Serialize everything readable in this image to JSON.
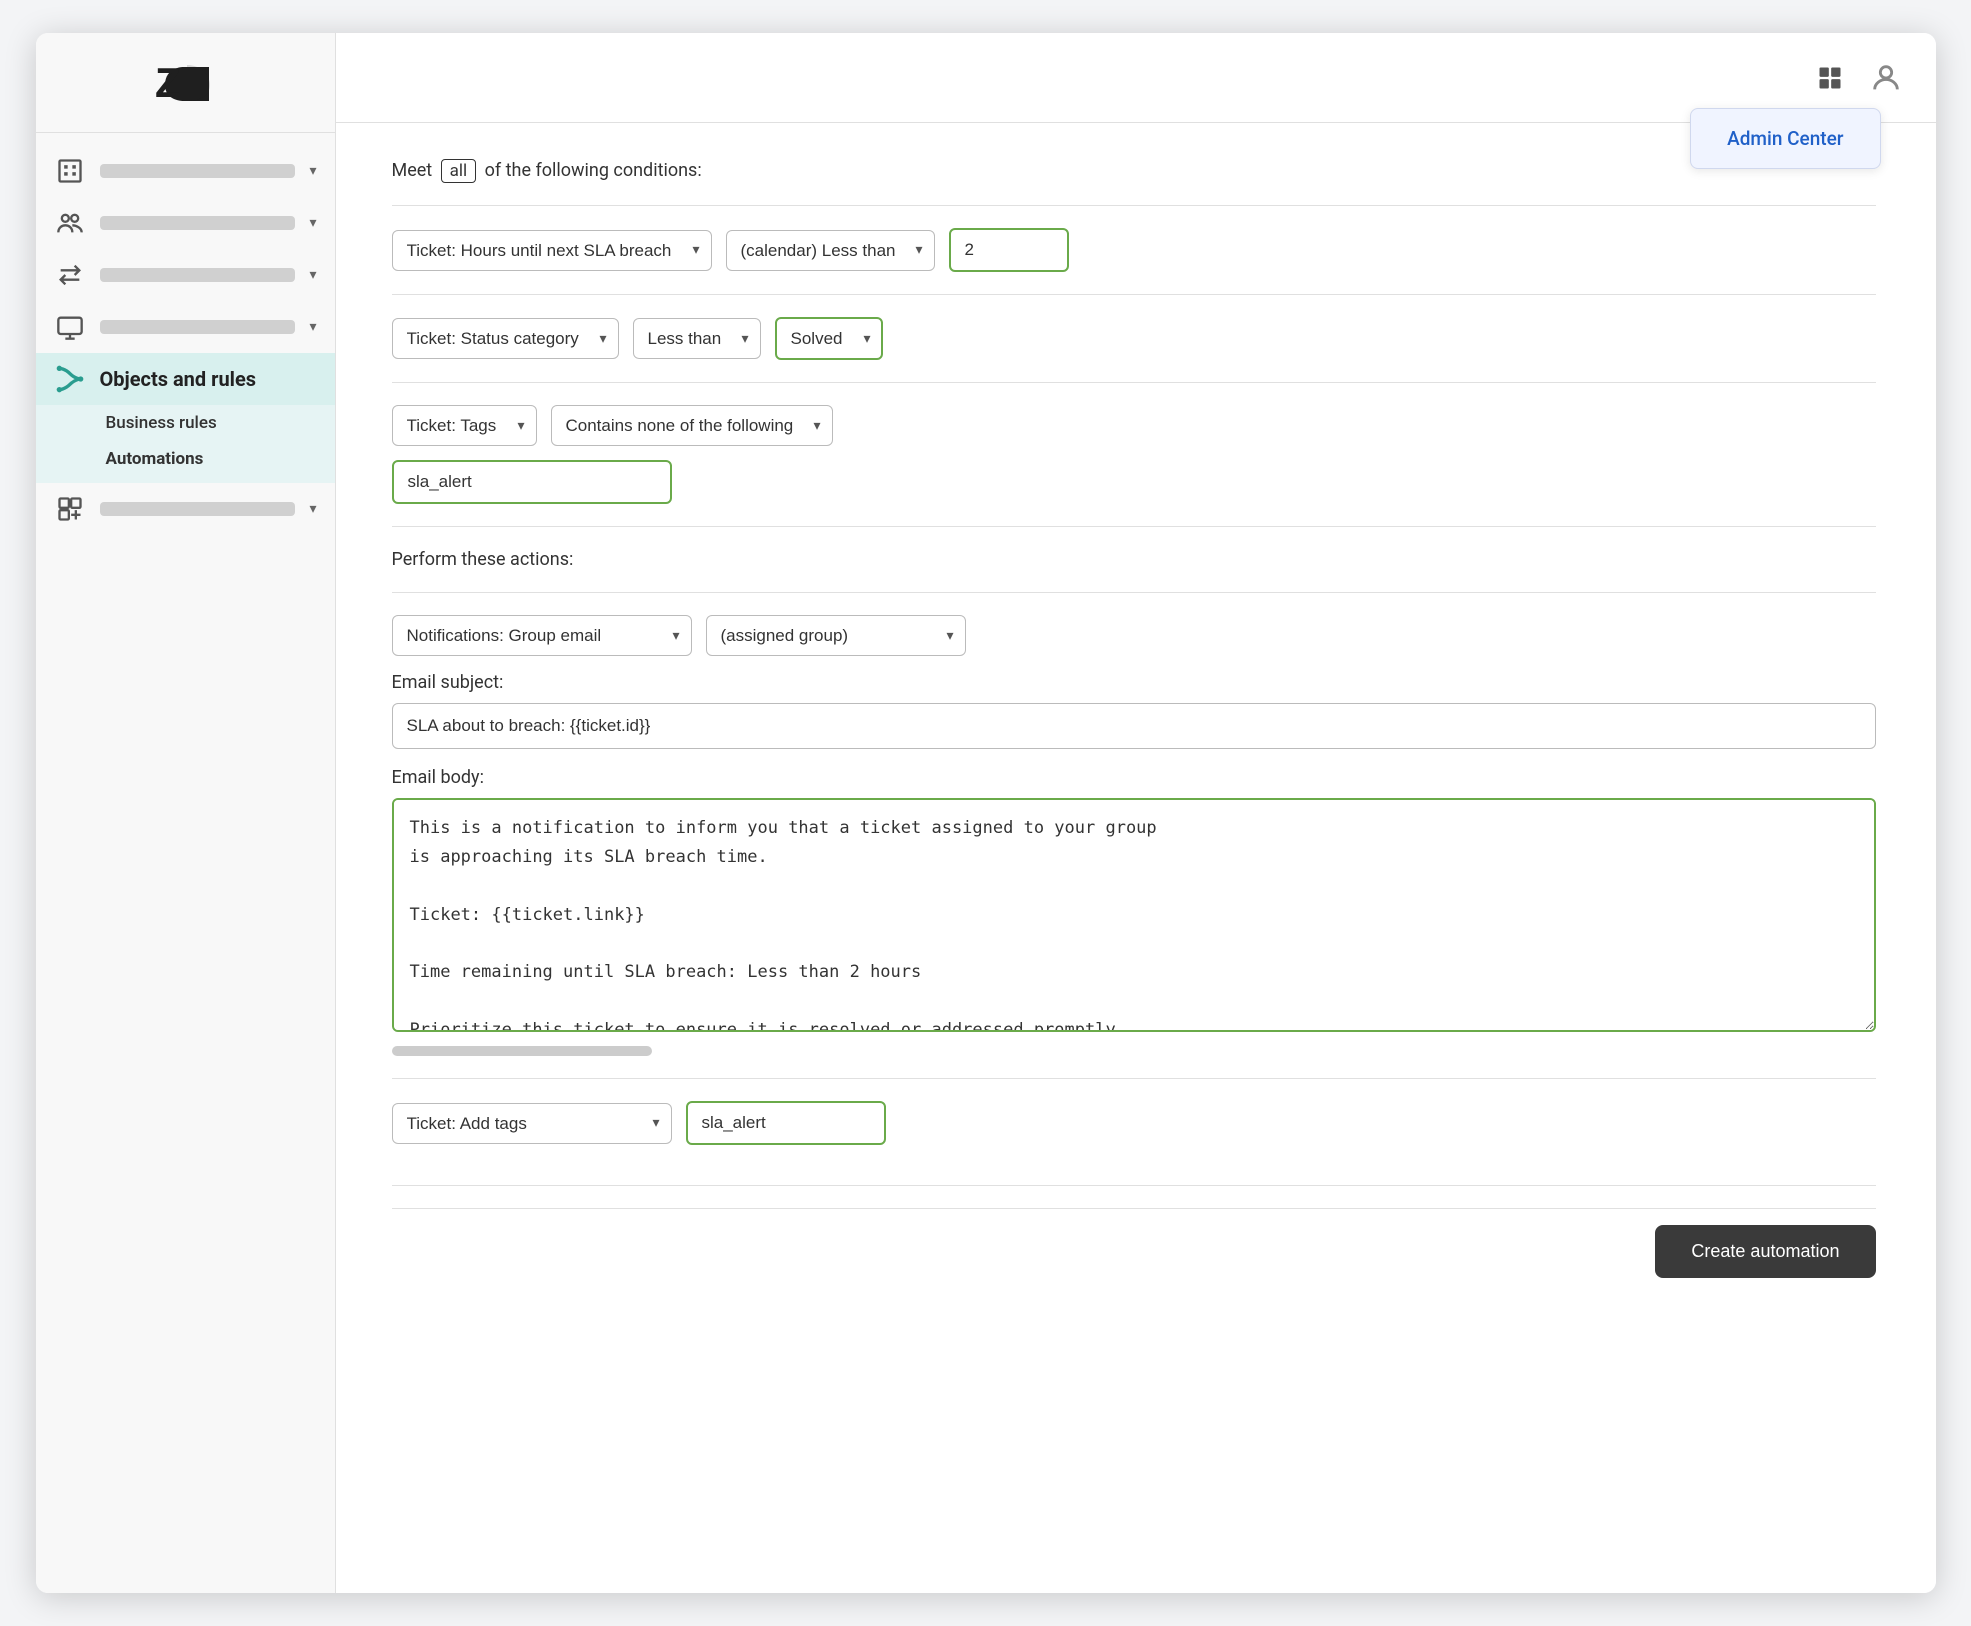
{
  "sidebar": {
    "logo_alt": "Zendesk Logo",
    "sections": [
      {
        "id": "buildings",
        "label": "",
        "active": false
      },
      {
        "id": "users",
        "label": "",
        "active": false
      },
      {
        "id": "transfer",
        "label": "",
        "active": false
      },
      {
        "id": "display",
        "label": "",
        "active": false
      },
      {
        "id": "objects",
        "label": "Objects and rules",
        "active": true
      },
      {
        "id": "apps",
        "label": "",
        "active": false
      }
    ],
    "subitems": [
      {
        "id": "business-rules",
        "label": "Business rules",
        "active": false
      },
      {
        "id": "automations",
        "label": "Automations",
        "active": true
      }
    ]
  },
  "header": {
    "admin_center_label": "Admin Center"
  },
  "conditions": {
    "meet_label": "Meet",
    "all_badge": "all",
    "of_label": "of the following conditions:",
    "row1": {
      "field_label": "Ticket: Hours until next SLA breach",
      "operator_label": "(calendar) Less than",
      "value": "2"
    },
    "row2": {
      "field_label": "Ticket: Status category",
      "operator_label": "Less than",
      "value_label": "Solved"
    },
    "row3": {
      "field_label": "Ticket: Tags",
      "operator_label": "Contains none of the following",
      "tag_value": "sla_alert"
    }
  },
  "actions": {
    "header_label": "Perform these actions:",
    "row1": {
      "field_label": "Notifications: Group email",
      "value_label": "(assigned group)"
    },
    "email_subject_label": "Email subject:",
    "email_subject_value": "SLA about to breach: {{ticket.id}}",
    "email_body_label": "Email body:",
    "email_body_value": "This is a notification to inform you that a ticket assigned to your group\nis approaching its SLA breach time.\n\nTicket: {{ticket.link}}\n\nTime remaining until SLA breach: Less than 2 hours\n\nPrioritize this ticket to ensure it is resolved or addressed promptly.",
    "row2": {
      "field_label": "Ticket: Add tags",
      "value": "sla_alert"
    }
  },
  "footer": {
    "create_btn_label": "Create automation"
  },
  "icons": {
    "buildings": "🏢",
    "users": "👥",
    "transfer": "⇄",
    "display": "🖥",
    "objects_rules": "⟳",
    "apps": "⊞",
    "grid": "⊞",
    "user_profile": "👤"
  }
}
